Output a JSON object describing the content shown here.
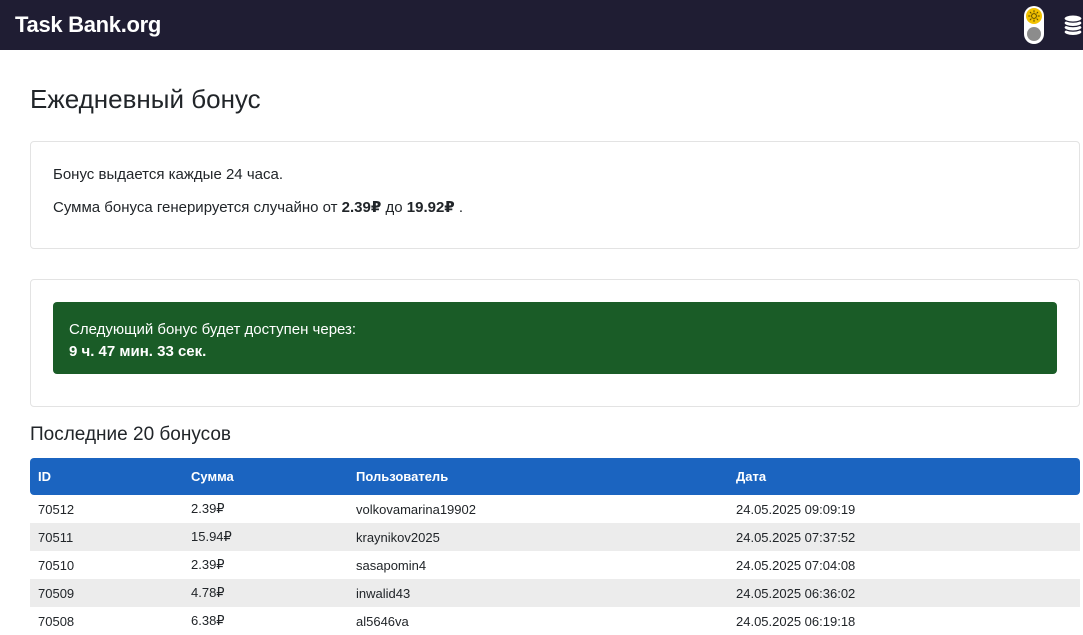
{
  "navbar": {
    "brand": "Task Bank.org"
  },
  "page": {
    "title": "Ежедневный бонус"
  },
  "info": {
    "line1": "Бонус выдается каждые 24 часа.",
    "line2_prefix": "Сумма бонуса генерируется случайно от",
    "min_amount": "2.39₽",
    "line2_middle": "до",
    "max_amount": "19.92₽",
    "line2_suffix": "."
  },
  "timer": {
    "label": "Следующий бонус будет доступен через:",
    "countdown": "9 ч. 47 мин. 33 сек."
  },
  "recent": {
    "title": "Последние 20 бонусов",
    "columns": {
      "id": "ID",
      "amount": "Сумма",
      "user": "Пользователь",
      "date": "Дата"
    },
    "rows": [
      {
        "id": "70512",
        "amount": "2.39₽",
        "user": "volkovamarina19902",
        "date": "24.05.2025 09:09:19"
      },
      {
        "id": "70511",
        "amount": "15.94₽",
        "user": "kraynikov2025",
        "date": "24.05.2025 07:37:52"
      },
      {
        "id": "70510",
        "amount": "2.39₽",
        "user": "sasapomin4",
        "date": "24.05.2025 07:04:08"
      },
      {
        "id": "70509",
        "amount": "4.78₽",
        "user": "inwalid43",
        "date": "24.05.2025 06:36:02"
      },
      {
        "id": "70508",
        "amount": "6.38₽",
        "user": "al5646va",
        "date": "24.05.2025 06:19:18"
      }
    ]
  },
  "colors": {
    "navbar": "#1f1d33",
    "alert_success": "#1a5c27",
    "table_header": "#1b64c0",
    "sun": "#f2c200"
  },
  "icons": {
    "theme_toggle": "sun-icon",
    "coins": "coins-icon"
  }
}
